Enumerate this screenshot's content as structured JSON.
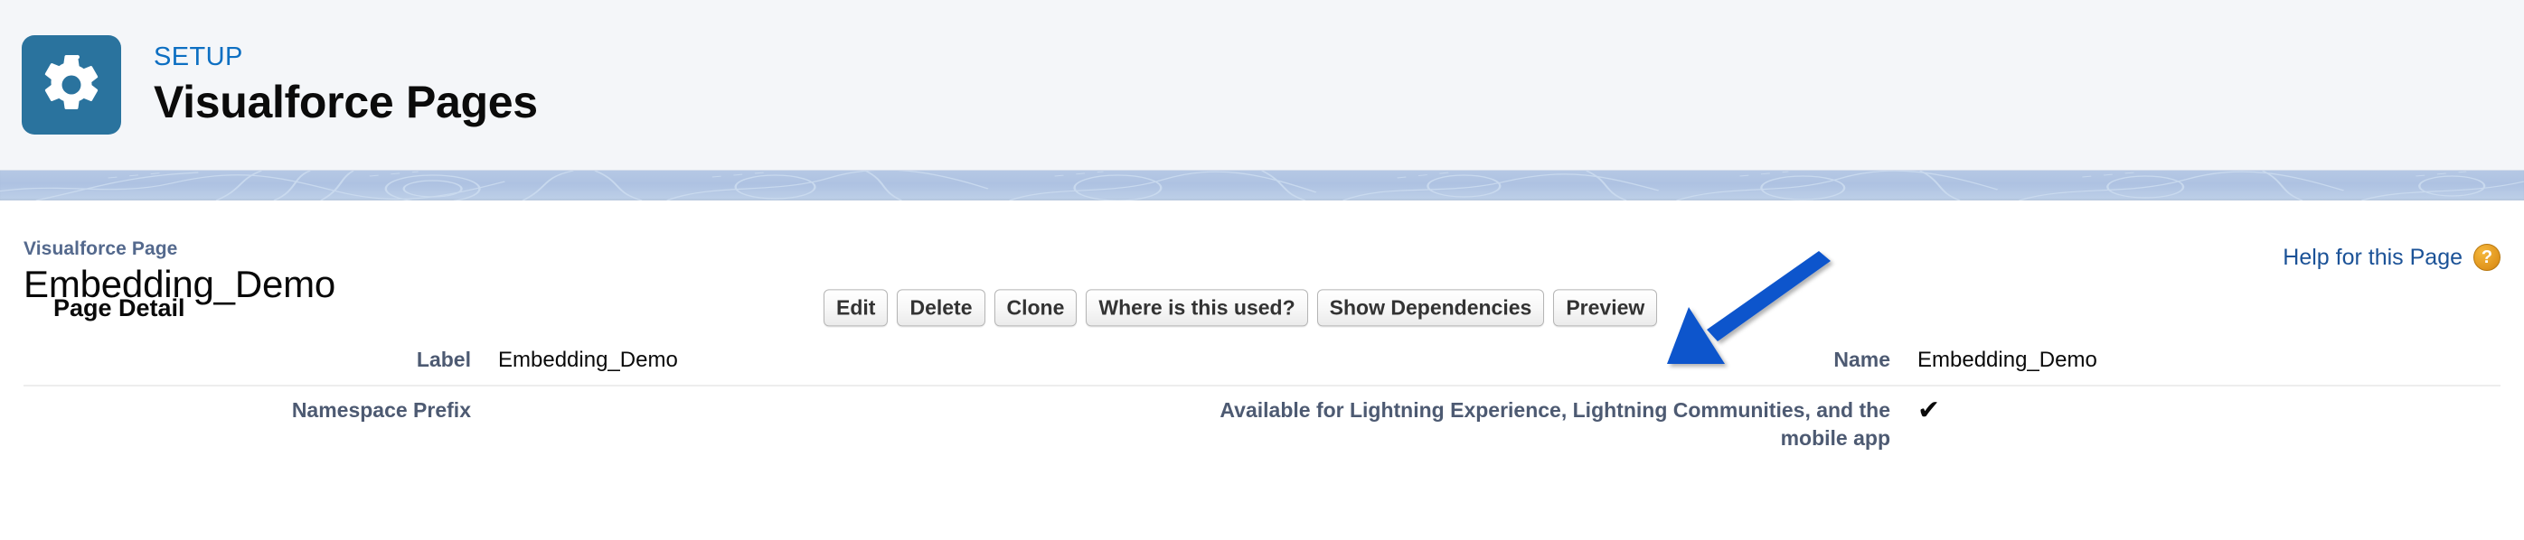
{
  "setup_header": {
    "eyebrow": "SETUP",
    "title": "Visualforce Pages",
    "icon": "gear-icon",
    "icon_tile_color": "#2a739e",
    "eyebrow_color": "#0d6fc2",
    "background_color": "#f4f6f9"
  },
  "banner": {
    "background_color": "#aec2e2",
    "pattern": "topographic-lines"
  },
  "record": {
    "type_label": "Visualforce Page",
    "name": "Embedding_Demo",
    "help_link_text": "Help for this Page",
    "help_icon": "question-mark-icon",
    "help_link_color": "#1b5297",
    "help_icon_color": "#e0941c"
  },
  "detail_section": {
    "title": "Page Detail",
    "buttons": [
      {
        "label": "Edit",
        "name": "edit-button"
      },
      {
        "label": "Delete",
        "name": "delete-button"
      },
      {
        "label": "Clone",
        "name": "clone-button"
      },
      {
        "label": "Where is this used?",
        "name": "where-is-this-used-button"
      },
      {
        "label": "Show Dependencies",
        "name": "show-dependencies-button"
      },
      {
        "label": "Preview",
        "name": "preview-button"
      }
    ],
    "fields": [
      {
        "left_label": "Label",
        "left_value": "Embedding_Demo",
        "right_label": "Name",
        "right_value": "Embedding_Demo"
      },
      {
        "left_label": "Namespace Prefix",
        "left_value": "",
        "right_label": "Available for Lightning Experience, Lightning Communities, and the mobile app",
        "right_value": "✔"
      }
    ]
  },
  "annotation": {
    "type": "arrow",
    "color": "#1155cc",
    "points_to": "preview-button",
    "direction": "down-left"
  }
}
